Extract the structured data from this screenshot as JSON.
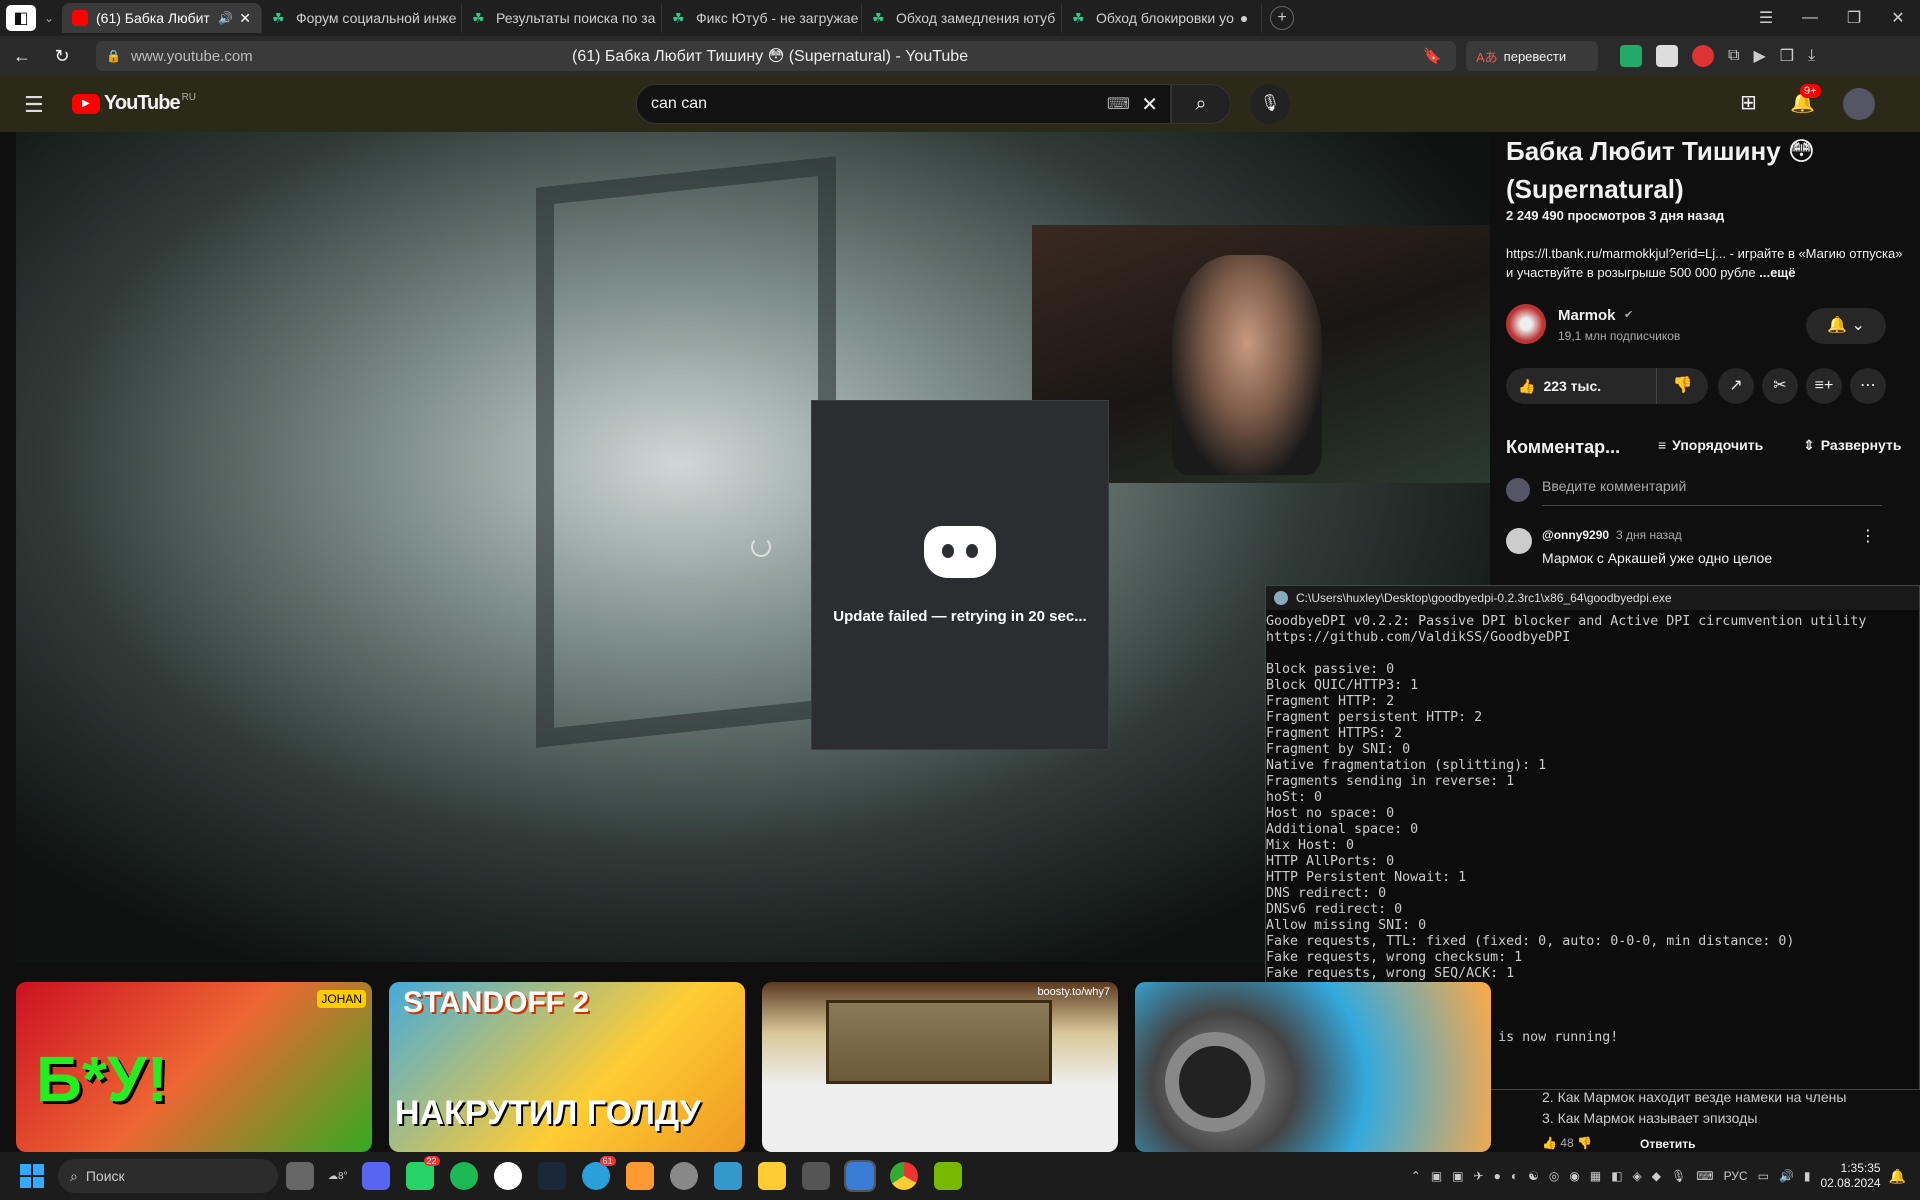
{
  "tabs": [
    {
      "label": "(61) Бабка Любит Ти",
      "active": true
    },
    {
      "label": "Форум социальной инже"
    },
    {
      "label": "Результаты поиска по за"
    },
    {
      "label": "Фикс Ютуб - не загружае"
    },
    {
      "label": "Обход замедления ютуб"
    },
    {
      "label": "Обход блокировки yo"
    }
  ],
  "address": {
    "url": "www.youtube.com",
    "title": "(61) Бабка Любит Тишину 😳 (Supernatural) - YouTube",
    "translate": "перевести"
  },
  "youtube": {
    "logo": "YouTube",
    "region": "RU",
    "search_value": "can can",
    "notif_count": "9+"
  },
  "video": {
    "title": "Бабка Любит Тишину 😳 (Supernatural)",
    "meta": "2 249 490 просмотров  3 дня назад",
    "desc": "https://l.tbank.ru/marmokkjul?erid=Lj... - играйте в «Магию отпуска» и участвуйте в розыгрыше 500 000 рубле",
    "more": "...ещё",
    "channel": "Marmok",
    "subs": "19,1 млн подписчиков",
    "likes": "223 тыс."
  },
  "comments": {
    "header": "Комментар...",
    "sort": "Упорядочить",
    "expand": "Развернуть",
    "placeholder": "Введите комментарий",
    "first_author": "@onny9290",
    "first_time": "3 дня назад",
    "first_text": "Мармок с Аркашей уже одно целое",
    "bottom_line1": "2. Как Мармок находит везде намеки на члены",
    "bottom_line2": "3. Как Мармок называет эпизоды",
    "bottom_likes": "48",
    "reply": "Ответить"
  },
  "discord": {
    "status": "Update failed — retrying in 20 sec..."
  },
  "console": {
    "title": "C:\\Users\\huxley\\Desktop\\goodbyedpi-0.2.3rc1\\x86_64\\goodbyedpi.exe",
    "output": "GoodbyeDPI v0.2.2: Passive DPI blocker and Active DPI circumvention utility\nhttps://github.com/ValdikSS/GoodbyeDPI\n\nBlock passive: 0\nBlock QUIC/HTTP3: 1\nFragment HTTP: 2\nFragment persistent HTTP: 2\nFragment HTTPS: 2\nFragment by SNI: 0\nNative fragmentation (splitting): 1\nFragments sending in reverse: 1\nhoSt: 0\nHost no space: 0\nAdditional space: 0\nMix Host: 0\nHTTP AllPorts: 0\nHTTP Persistent Nowait: 1\nDNS redirect: 0\nDNSv6 redirect: 0\nAllow missing SNI: 0\nFake requests, TTL: fixed (fixed: 0, auto: 0-0-0, min distance: 0)\nFake requests, wrong checksum: 1\nFake requests, wrong SEQ/ACK: 1\nMax payload size: 1200\n\nOpening filter\nFilter activated, GoodbyeDPI is now running!"
  },
  "thumbnails": [
    {
      "overlay": "Б*У!",
      "badge": "JOHAN"
    },
    {
      "overlay": "STANDOFF 2",
      "sub": "НАКРУТИЛ ГОЛДУ"
    },
    {
      "overlay": "boosty.to/why7"
    },
    {
      "overlay": ""
    }
  ],
  "taskbar": {
    "search": "Поиск",
    "temp": "8°",
    "lang": "РУС",
    "time": "1:35:35",
    "date": "02.08.2024",
    "whatsapp_badge": "22",
    "telegram_badge": "61"
  }
}
